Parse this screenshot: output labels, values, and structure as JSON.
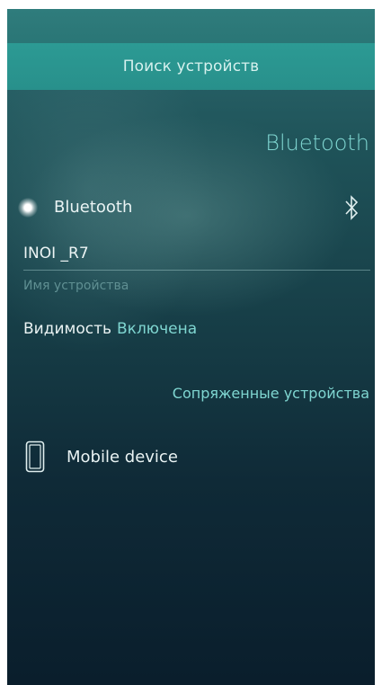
{
  "pulley_menu": {
    "item": "Поиск устройств"
  },
  "page": {
    "header": "Bluetooth"
  },
  "bluetooth_switch": {
    "label": "Bluetooth",
    "state": "on"
  },
  "device_name": {
    "value": "INOI _R7",
    "description": "Имя устройства"
  },
  "visibility": {
    "label": "Видимость",
    "value": "Включена"
  },
  "paired_section": {
    "header": "Сопряженные устройства",
    "devices": [
      {
        "name": "Mobile device",
        "icon": "phone-icon"
      }
    ]
  },
  "colors": {
    "highlight": "#7fd6d1",
    "pulley_bg": "#2c9a94",
    "primary_text": "#e9f3f3",
    "secondary_text": "#5f8f92"
  }
}
